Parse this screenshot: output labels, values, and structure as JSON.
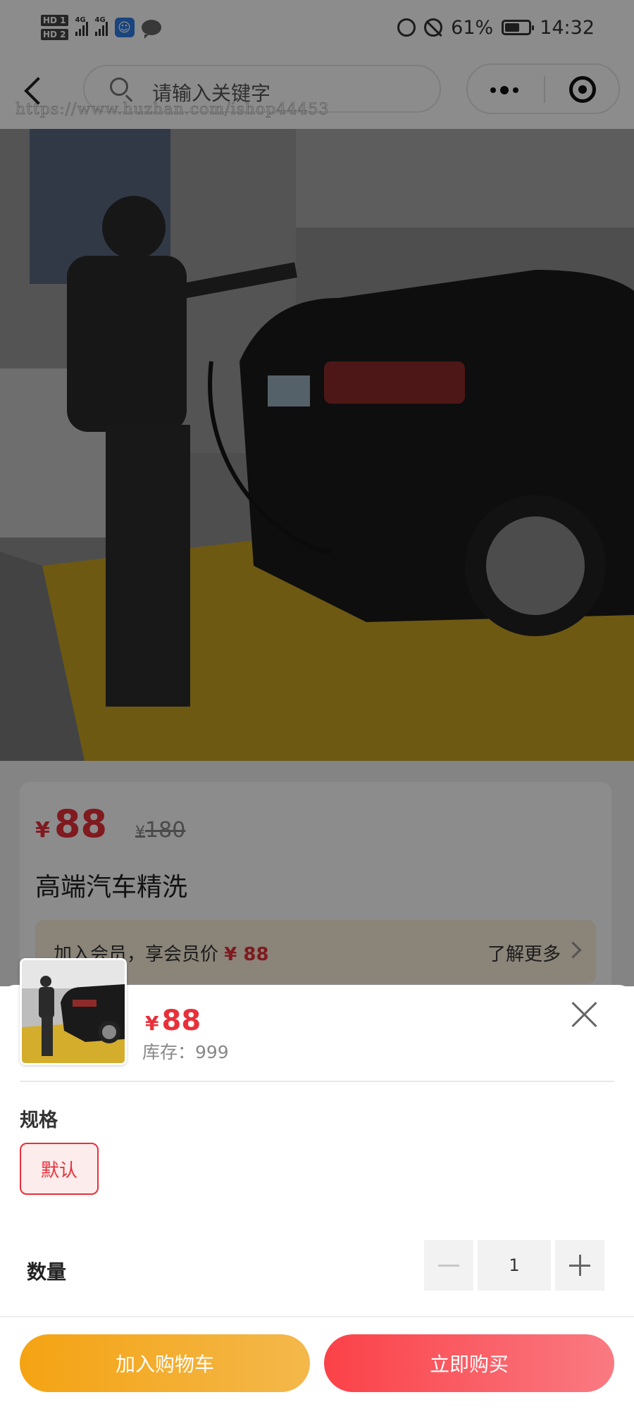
{
  "status_bar": {
    "hd1": "HD 1",
    "hd2": "HD 2",
    "net1": "4G",
    "net2": "4G",
    "app_icon": "app-notification-icon",
    "battery_text": "61%",
    "battery_level": 0.61,
    "time": "14:32"
  },
  "nav": {
    "search_placeholder": "请输入关键字",
    "watermark": "https://www.huzhan.com/ishop44453"
  },
  "product": {
    "currency": "¥",
    "price": "88",
    "original_price": "180",
    "title": "高端汽车精洗",
    "member_text": "加入会员，享会员价",
    "member_price": "¥ 88",
    "learn_more": "了解更多"
  },
  "sheet": {
    "currency": "¥",
    "price": "88",
    "stock": "库存：999",
    "spec_label": "规格",
    "spec_option": "默认",
    "qty_label": "数量",
    "qty_value": "1",
    "add_to_cart": "加入购物车",
    "buy_now": "立即购买"
  },
  "colors": {
    "accent_red": "#e8303a",
    "cart_orange": "#f4a313",
    "buy_red": "#fb4148",
    "member_bg": "#fbf0dc"
  }
}
